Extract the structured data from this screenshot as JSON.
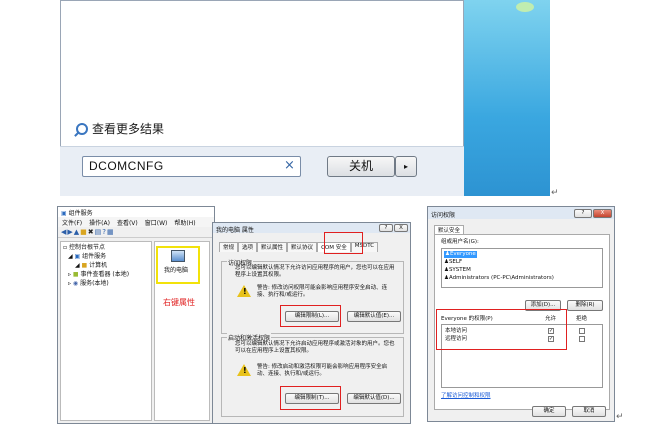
{
  "start_menu": {
    "see_more": "查看更多结果",
    "search_value": "DCOMCNFG",
    "clear_glyph": "×",
    "shutdown_label": "关机",
    "shutdown_arrow": "▸",
    "paragraph_mark": "↵"
  },
  "component_services": {
    "title": "组件服务",
    "menu": [
      "文件(F)",
      "操作(A)",
      "查看(V)",
      "窗口(W)",
      "帮助(H)"
    ],
    "tree": [
      "控制台根节点",
      "组件服务",
      "计算机",
      "我的电脑",
      "事件查看器 (本地)",
      "服务(本地)"
    ],
    "right_pane_item": "我的电脑",
    "annotation": "右键属性"
  },
  "properties": {
    "title": "我的电脑 属性",
    "help_glyph": "?",
    "close_glyph": "X",
    "tabs": [
      "常规",
      "选项",
      "默认属性",
      "默认协议",
      "COM 安全",
      "MSDTC"
    ],
    "access_group": "访问权限",
    "access_desc": "您可以编辑默认情况下允许访问应用程序的用户，您也可以在应用程序上设置其权限。",
    "access_warn": "警告: 修改访问权限可能会影响应用程序安全启动、连接、执行和/或运行。",
    "edit_limits": "编辑限制(L)...",
    "edit_default": "编辑默认值(E)...",
    "launch_group": "启动和激活权限",
    "launch_desc": "您可以编辑默认情况下允许启动应用程序或激活对象的用户。您也可以在应用程序上设置其权限。",
    "launch_warn": "警告: 修改启动和激活权限可能会影响应用程序安全启动、连接、执行和/或运行。",
    "edit_limits2": "编辑限制(T)...",
    "edit_default2": "编辑默认值(D)..."
  },
  "access_permission": {
    "title": "访问权限",
    "help_glyph": "?",
    "close_glyph": "X",
    "tab": "默认安全",
    "group_label": "组或用户名(G):",
    "users": [
      "Everyone",
      "SELF",
      "SYSTEM",
      "Administrators (PC-PC\\Administrators)"
    ],
    "add_button": "添加(D)...",
    "remove_button": "删除(R)",
    "perm_header": "Everyone 的权限(P)",
    "allow_header": "允许",
    "deny_header": "拒绝",
    "perms": [
      "本地访问",
      "远程访问"
    ],
    "check_glyph": "✓",
    "link": "了解访问控制和权限",
    "ok_button": "确定",
    "cancel_button": "取消",
    "paragraph_mark": "↵"
  }
}
